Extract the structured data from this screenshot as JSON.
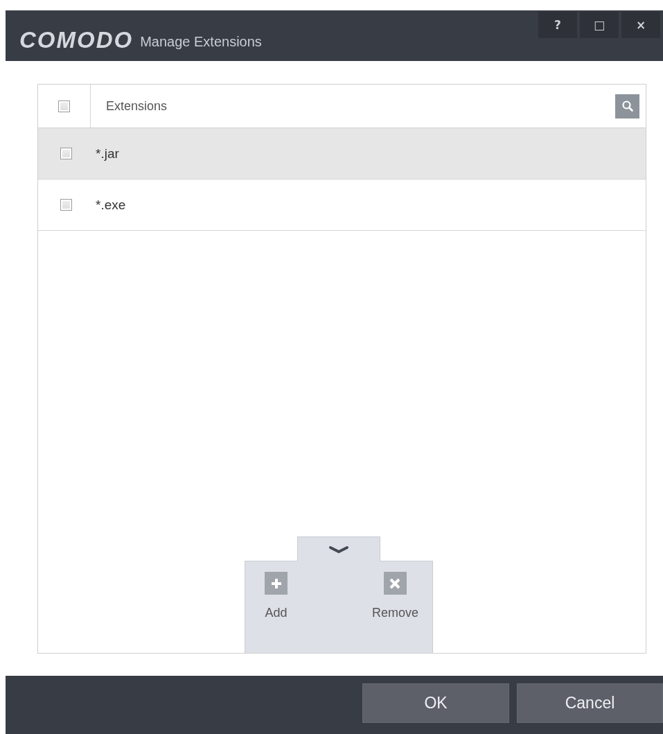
{
  "window": {
    "logo": "COMODO",
    "title": "Manage Extensions",
    "controls": [
      "?",
      "□",
      "×"
    ]
  },
  "table": {
    "select_all": {
      "checked": false
    },
    "column": "Extensions",
    "rows": [
      {
        "extension": "*.jar",
        "checked": false,
        "selected": true
      },
      {
        "extension": "*.exe",
        "checked": false,
        "selected": false
      }
    ]
  },
  "actions": [
    {
      "kind": "add",
      "label": "Add"
    },
    {
      "kind": "remove",
      "label": "Remove"
    }
  ],
  "buttons": [
    "OK",
    "Cancel"
  ]
}
